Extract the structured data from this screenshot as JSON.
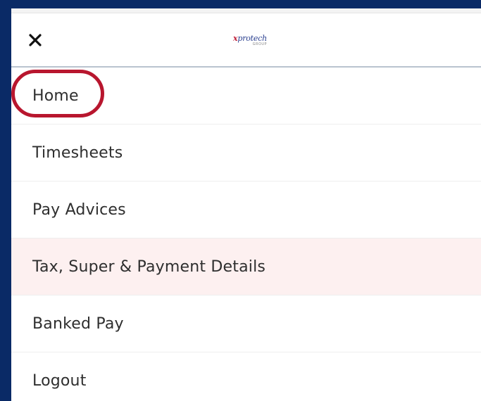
{
  "header": {
    "close_label": "✕",
    "logo_main": "protech",
    "logo_prefix": "x",
    "logo_sub": "GROUP"
  },
  "menu": {
    "items": [
      {
        "label": "Home",
        "annotated": true
      },
      {
        "label": "Timesheets"
      },
      {
        "label": "Pay Advices"
      },
      {
        "label": "Tax, Super & Payment Details",
        "highlighted": true
      },
      {
        "label": "Banked Pay"
      },
      {
        "label": "Logout"
      }
    ]
  },
  "colors": {
    "frame": "#0a2a66",
    "annotation": "#b8162e",
    "highlight_row": "#fdf0f0",
    "text": "#2e2e2e"
  }
}
